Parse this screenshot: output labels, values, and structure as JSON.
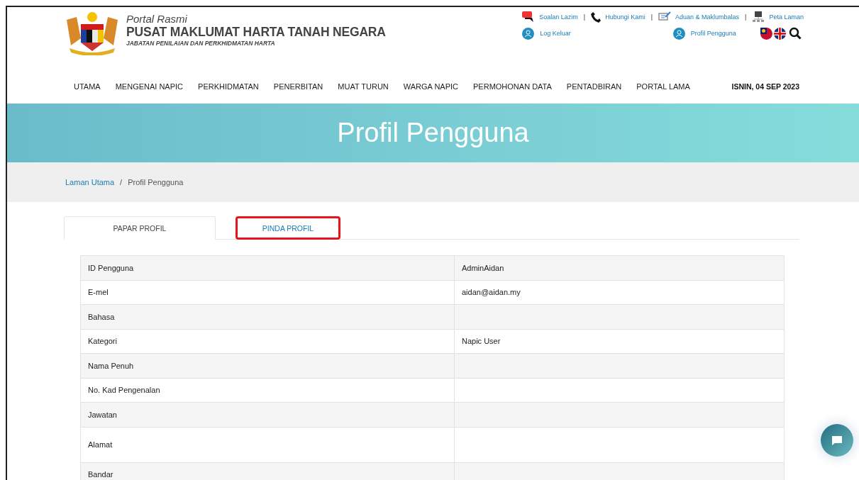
{
  "header": {
    "subtitle": "Portal Rasmi",
    "title": "PUSAT MAKLUMAT HARTA TANAH NEGARA",
    "department": "JABATAN PENILAIAN DAN PERKHIDMATAN HARTA"
  },
  "top_link_separator": "|",
  "breadcrumb_separator": "/",
  "top_links": [
    {
      "kind": "faq",
      "label": "Soalan Lazim"
    },
    {
      "kind": "phone",
      "label": "Hubungi Kami"
    },
    {
      "kind": "feedback",
      "label": "Aduan & Maklumbalas"
    },
    {
      "kind": "sitemap",
      "label": "Peta Laman"
    }
  ],
  "user_links": [
    {
      "label": "Log Keluar"
    },
    {
      "label": "Profil Pengguna"
    }
  ],
  "nav": {
    "items": [
      "UTAMA",
      "MENGENAI NAPIC",
      "PERKHIDMATAN",
      "PENERBITAN",
      "MUAT TURUN",
      "WARGA NAPIC",
      "PERMOHONAN DATA",
      "PENTADBIRAN",
      "PORTAL LAMA"
    ],
    "date": "ISNIN, 04 SEP 2023"
  },
  "banner": {
    "title": "Profil Pengguna"
  },
  "breadcrumb": [
    {
      "label": "Laman Utama",
      "kind": "link"
    },
    {
      "label": "Profil Pengguna",
      "kind": "current"
    }
  ],
  "tabs": [
    {
      "label": "PAPAR PROFIL",
      "selected": true,
      "highlighted": false
    },
    {
      "label": "PINDA PROFIL",
      "selected": false,
      "highlighted": true
    }
  ],
  "profile_table": {
    "rows": [
      {
        "label": "ID Pengguna",
        "value": "AdminAidan",
        "tall": false
      },
      {
        "label": "E-mel",
        "value": "aidan@aidan.my",
        "tall": false
      },
      {
        "label": "Bahasa",
        "tall": false
      },
      {
        "label": "Kategori",
        "value": "Napic User",
        "tall": false
      },
      {
        "label": "Nama Penuh",
        "tall": false
      },
      {
        "label": "No. Kad Pengenalan",
        "tall": false
      },
      {
        "label": "Jawatan",
        "tall": false
      },
      {
        "label": "Alamat",
        "tall": true
      },
      {
        "label": "Bandar",
        "tall": false
      }
    ]
  }
}
